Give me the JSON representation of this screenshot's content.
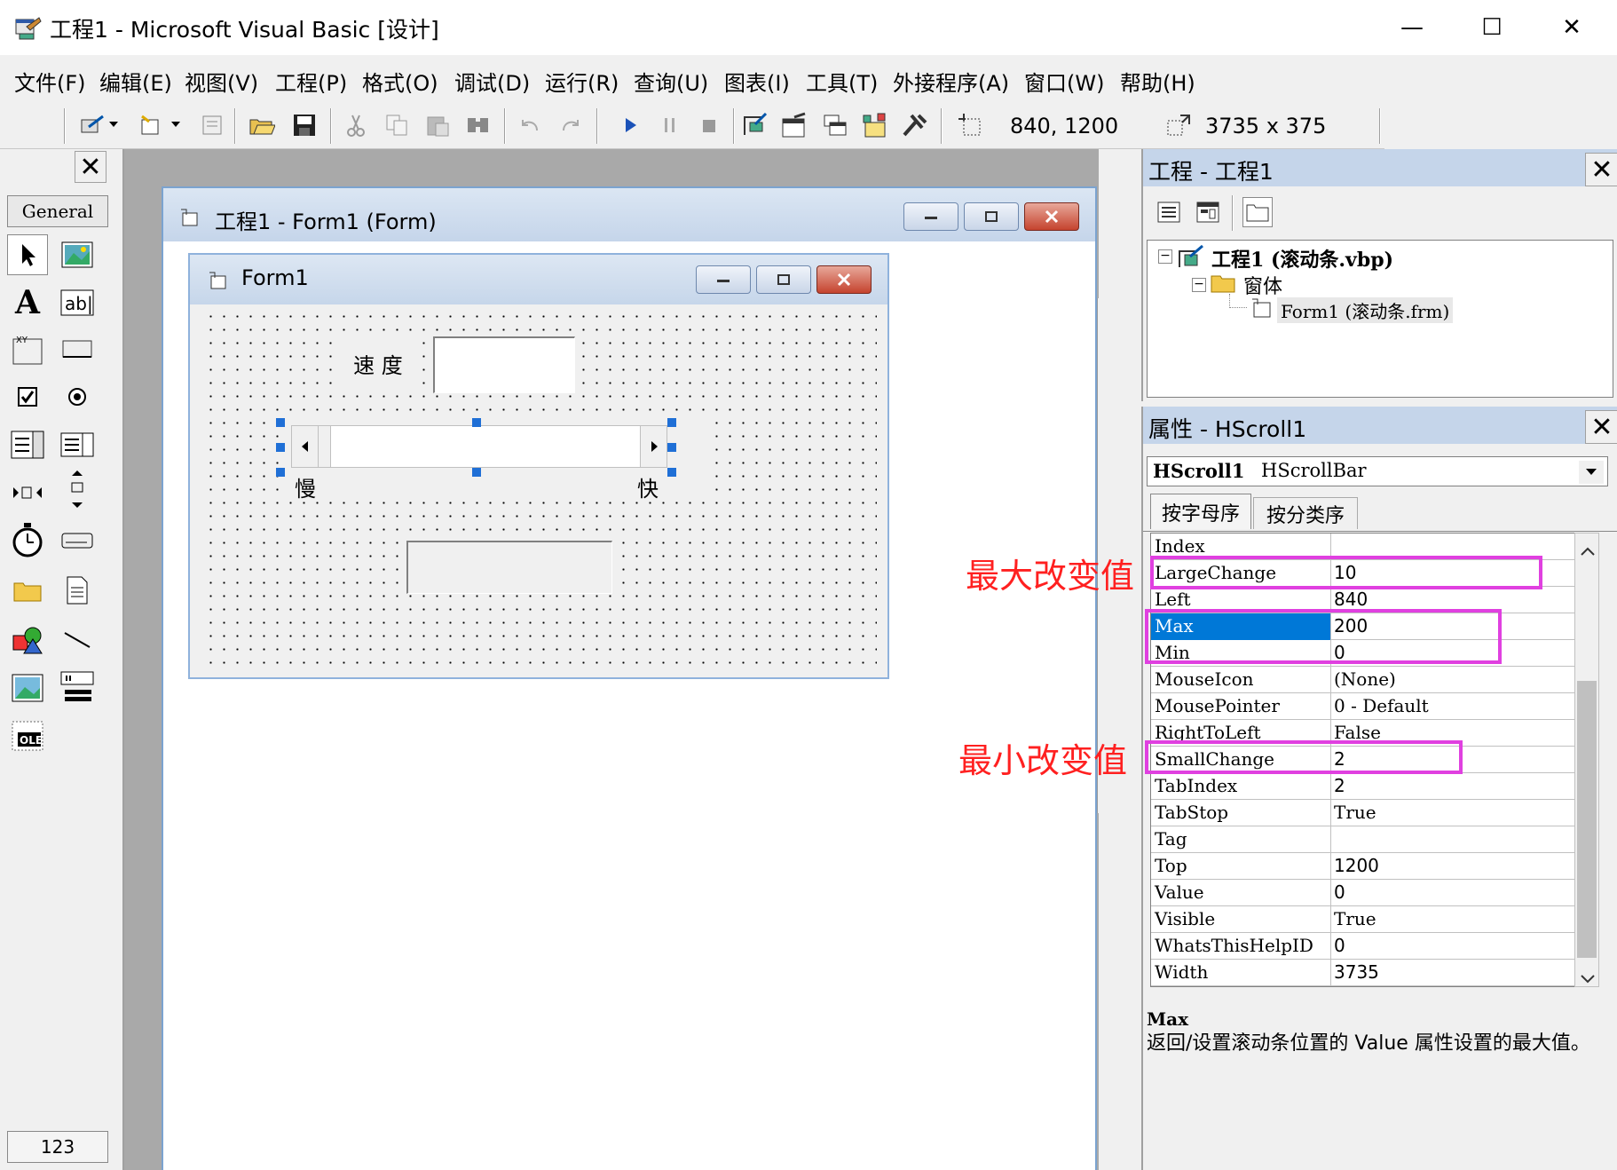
{
  "window": {
    "title": "工程1 - Microsoft Visual Basic [设计]",
    "min_label": "—",
    "max_label": "☐",
    "close_label": "✕"
  },
  "menu": [
    "文件(F)",
    "编辑(E)",
    "视图(V)",
    "工程(P)",
    "格式(O)",
    "调试(D)",
    "运行(R)",
    "查询(U)",
    "图表(I)",
    "工具(T)",
    "外接程序(A)",
    "窗口(W)",
    "帮助(H)"
  ],
  "toolbar": {
    "position": "840, 1200",
    "size": "3735 x 375"
  },
  "toolbox": {
    "close_label": "✕",
    "tab_label": "General",
    "bottom_label": "123"
  },
  "designer": {
    "title": "工程1 - Form1 (Form)",
    "form": {
      "title": "Form1",
      "speed_label": "速 度",
      "slow_label": "慢",
      "fast_label": "快"
    }
  },
  "project": {
    "title": "工程 - 工程1",
    "close_label": "✕",
    "tree": {
      "project": "工程1 (滚动条.vbp)",
      "folder": "窗体",
      "form": "Form1 (滚动条.frm)"
    }
  },
  "properties": {
    "title": "属性 - HScroll1",
    "close_label": "✕",
    "object_name": "HScroll1",
    "object_type": "HScrollBar",
    "tabs": [
      "按字母序",
      "按分类序"
    ],
    "rows": [
      {
        "name": "Index",
        "value": ""
      },
      {
        "name": "LargeChange",
        "value": "10"
      },
      {
        "name": "Left",
        "value": "840"
      },
      {
        "name": "Max",
        "value": "200"
      },
      {
        "name": "Min",
        "value": "0"
      },
      {
        "name": "MouseIcon",
        "value": "(None)"
      },
      {
        "name": "MousePointer",
        "value": "0 - Default"
      },
      {
        "name": "RightToLeft",
        "value": "False"
      },
      {
        "name": "SmallChange",
        "value": "2"
      },
      {
        "name": "TabIndex",
        "value": "2"
      },
      {
        "name": "TabStop",
        "value": "True"
      },
      {
        "name": "Tag",
        "value": ""
      },
      {
        "name": "Top",
        "value": "1200"
      },
      {
        "name": "Value",
        "value": "0"
      },
      {
        "name": "Visible",
        "value": "True"
      },
      {
        "name": "WhatsThisHelpID",
        "value": "0"
      },
      {
        "name": "Width",
        "value": "3735"
      }
    ],
    "desc_title": "Max",
    "desc_text": "返回/设置滚动条位置的 Value 属性设置的最大值。"
  },
  "annotations": {
    "max_change": "最大改变值",
    "min_change": "最小改变值"
  },
  "colors": {
    "highlight": "#e040e0",
    "annotation": "#ff2020",
    "selection": "#0078d7"
  }
}
